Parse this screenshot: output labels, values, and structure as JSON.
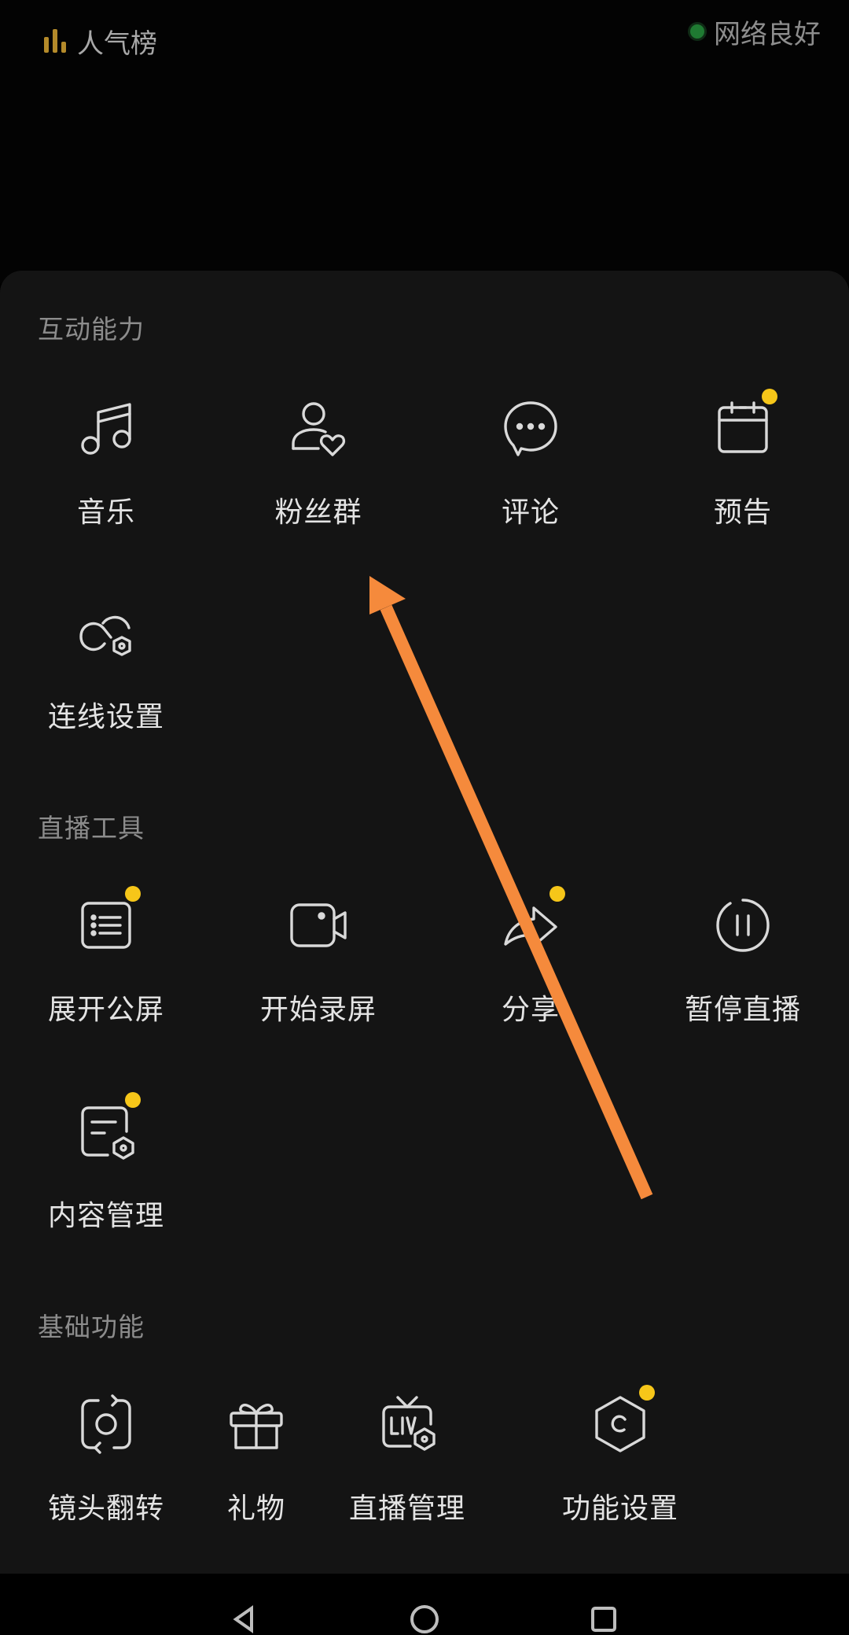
{
  "status": {
    "rank_label": "人气榜",
    "network_label": "网络良好",
    "network_color": "#1f7a32"
  },
  "sections": [
    {
      "title": "互动能力",
      "items": [
        {
          "label": "音乐",
          "icon": "music-note-icon",
          "badge": false
        },
        {
          "label": "粉丝群",
          "icon": "fan-group-icon",
          "badge": false
        },
        {
          "label": "评论",
          "icon": "comment-bubble-icon",
          "badge": false
        },
        {
          "label": "预告",
          "icon": "calendar-icon",
          "badge": true
        },
        {
          "label": "连线设置",
          "icon": "link-settings-icon",
          "badge": false
        }
      ]
    },
    {
      "title": "直播工具",
      "items": [
        {
          "label": "展开公屏",
          "icon": "public-screen-icon",
          "badge": true
        },
        {
          "label": "开始录屏",
          "icon": "video-camera-icon",
          "badge": false
        },
        {
          "label": "分享",
          "icon": "share-arrow-icon",
          "badge": true
        },
        {
          "label": "暂停直播",
          "icon": "pause-icon",
          "badge": false
        },
        {
          "label": "内容管理",
          "icon": "content-settings-icon",
          "badge": true
        }
      ]
    },
    {
      "title": "基础功能",
      "items": [
        {
          "label": "镜头翻转",
          "icon": "camera-flip-icon",
          "badge": false
        },
        {
          "label": "礼物",
          "icon": "gift-icon",
          "badge": false
        },
        {
          "label": "直播管理",
          "icon": "live-tv-settings-icon",
          "badge": false
        },
        {
          "label": "功能设置",
          "icon": "hexagon-settings-icon",
          "badge": true
        }
      ]
    }
  ],
  "colors": {
    "badge": "#f6c619",
    "annotation_arrow": "#f58a3c"
  }
}
